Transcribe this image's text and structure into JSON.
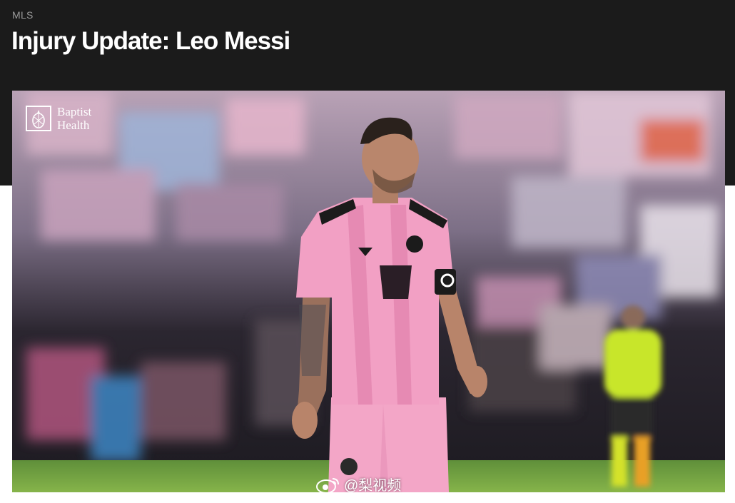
{
  "header": {
    "category": "MLS",
    "title": "Injury Update: Leo Messi"
  },
  "hero": {
    "alt": "Leo Messi in a pink Inter Miami kit on the pitch",
    "sponsor": {
      "icon": "pineapple-logo-icon",
      "text": "Baptist Health"
    },
    "watermark": {
      "icon": "weibo-icon",
      "text": "@梨视频"
    }
  },
  "colors": {
    "header_bg": "#1b1b1b",
    "title": "#ffffff",
    "category": "#9a9a9a",
    "kit_pink": "#f0a0c0",
    "referee_shirt": "#c8e62a"
  }
}
